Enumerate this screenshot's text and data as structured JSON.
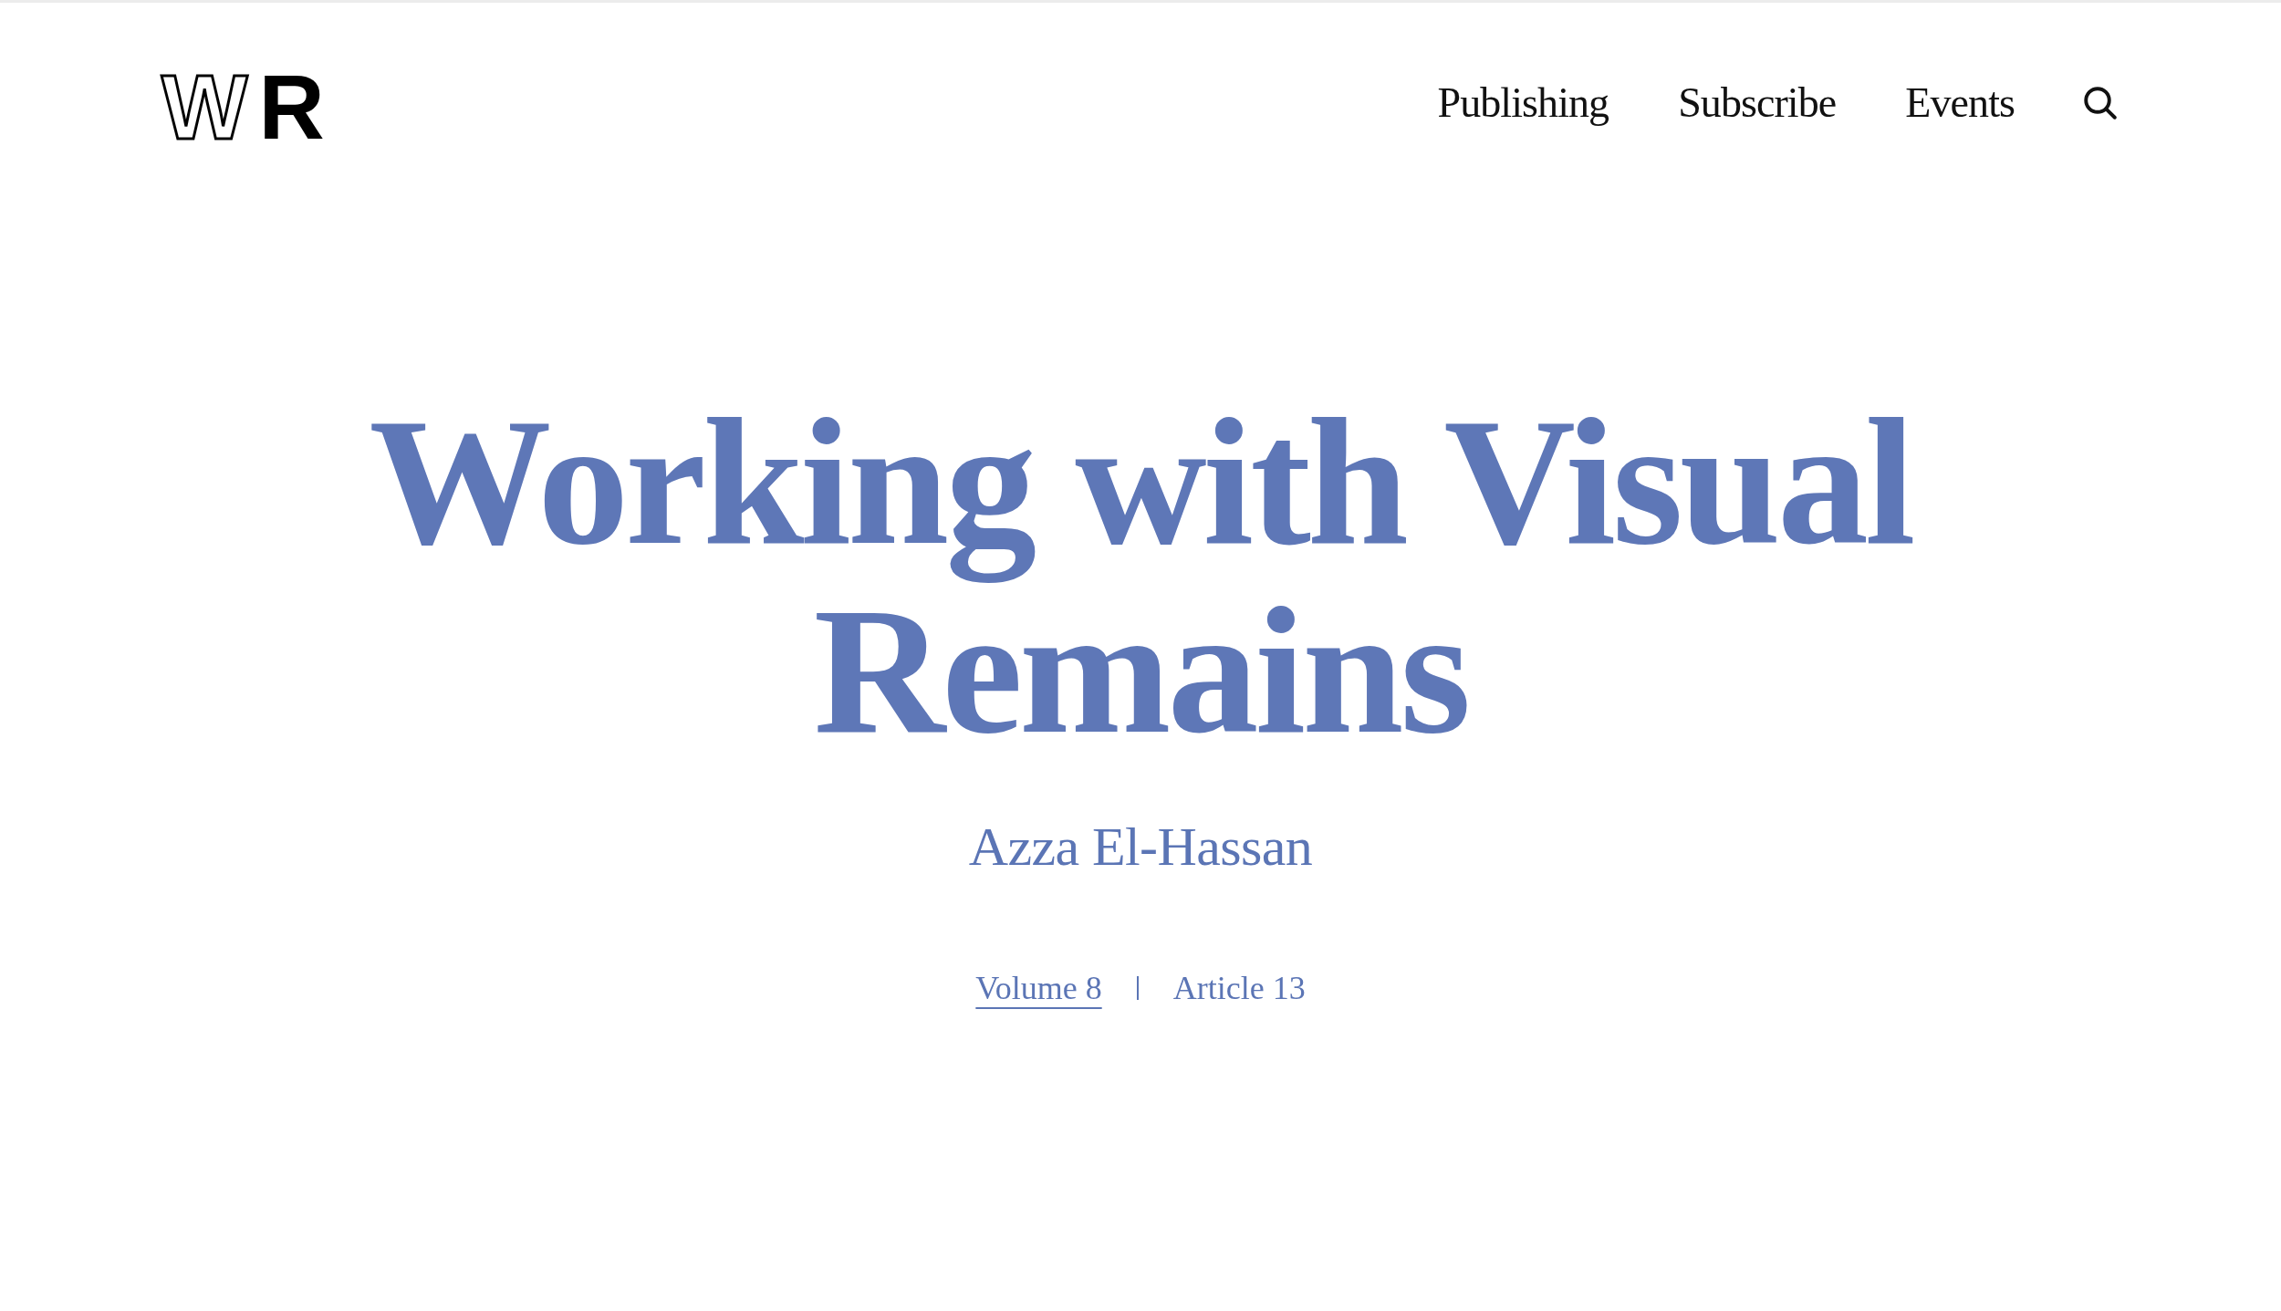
{
  "header": {
    "logo": {
      "parts": [
        {
          "text": "W",
          "kind": "outline"
        },
        {
          "text": "R",
          "kind": "solid"
        }
      ]
    },
    "nav": [
      {
        "label": "Publishing"
      },
      {
        "label": "Subscribe"
      },
      {
        "label": "Events"
      }
    ]
  },
  "article": {
    "title": "Working with Visual Remains",
    "author": "Azza El-Hassan",
    "meta": [
      {
        "text": "Volume 8",
        "kind": "link"
      },
      {
        "text": "Article 13",
        "kind": "text"
      }
    ]
  }
}
